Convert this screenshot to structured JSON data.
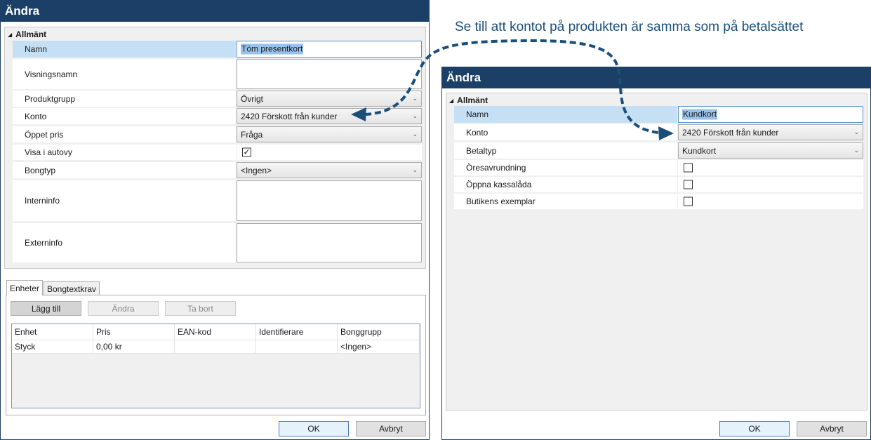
{
  "annotation": "Se till att kontot på produkten är samma som på betalsättet",
  "colors": {
    "title_bar": "#1b3f66",
    "annotation": "#1b4f7a",
    "selection": "#c5e0f5"
  },
  "left_window": {
    "title": "Ändra",
    "section": "Allmänt",
    "fields": {
      "namn": {
        "label": "Namn",
        "value": "Töm presentkort"
      },
      "visningsnamn": {
        "label": "Visningsnamn",
        "value": ""
      },
      "produktgrupp": {
        "label": "Produktgrupp",
        "value": "Övrigt"
      },
      "konto": {
        "label": "Konto",
        "value": "2420 Förskott från kunder"
      },
      "oppet_pris": {
        "label": "Öppet pris",
        "value": "Fråga"
      },
      "visa_i_autovy": {
        "label": "Visa i autovy",
        "checked": true,
        "check_glyph": "✓"
      },
      "bongtyp": {
        "label": "Bongtyp",
        "value": "<Ingen>"
      },
      "interninfo": {
        "label": "Interninfo",
        "value": ""
      },
      "externinfo": {
        "label": "Externinfo",
        "value": ""
      }
    },
    "tabs": [
      "Enheter",
      "Bongtextkrav"
    ],
    "buttons": {
      "add": "Lägg till",
      "edit": "Ändra",
      "remove": "Ta bort"
    },
    "grid": {
      "columns": [
        "Enhet",
        "Pris",
        "EAN-kod",
        "Identifierare",
        "Bonggrupp"
      ],
      "rows": [
        [
          "Styck",
          "0,00 kr",
          "",
          "",
          "<Ingen>"
        ]
      ]
    },
    "ok": "OK",
    "cancel": "Avbryt"
  },
  "right_window": {
    "title": "Ändra",
    "section": "Allmänt",
    "fields": {
      "namn": {
        "label": "Namn",
        "value": "Kundkort"
      },
      "konto": {
        "label": "Konto",
        "value": "2420 Förskott från kunder"
      },
      "betaltyp": {
        "label": "Betaltyp",
        "value": "Kundkort"
      },
      "oresavrundning": {
        "label": "Öresavrundning",
        "checked": false
      },
      "oppna_kassalada": {
        "label": "Öppna kassalåda",
        "checked": false
      },
      "butikens_exemplar": {
        "label": "Butikens exemplar",
        "checked": false
      }
    },
    "ok": "OK",
    "cancel": "Avbryt"
  }
}
